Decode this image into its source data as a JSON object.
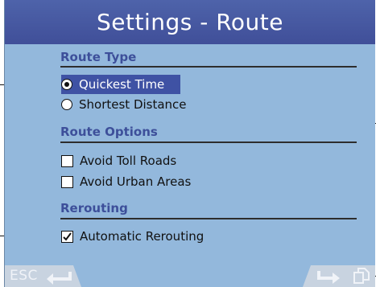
{
  "window": {
    "title": "Settings - Route"
  },
  "sections": {
    "route_type": {
      "title": "Route Type",
      "options": [
        {
          "label": "Quickest Time",
          "selected": true
        },
        {
          "label": "Shortest Distance",
          "selected": false
        }
      ]
    },
    "route_options": {
      "title": "Route Options",
      "options": [
        {
          "label": "Avoid Toll Roads",
          "checked": false
        },
        {
          "label": "Avoid Urban Areas",
          "checked": false
        }
      ]
    },
    "rerouting": {
      "title": "Rerouting",
      "options": [
        {
          "label": "Automatic Rerouting",
          "checked": true
        }
      ]
    }
  },
  "bottom_bar": {
    "esc_label": "ESC",
    "icons": [
      "enter-arrow-icon",
      "turn-arrow-icon",
      "pages-icon"
    ]
  },
  "colors": {
    "title_bar": "#4a5ea6",
    "background": "#93b8dc",
    "section_title": "#3d4f9a",
    "selection": "#3f52a4",
    "soft_key_tab": "#c8d3e0"
  }
}
